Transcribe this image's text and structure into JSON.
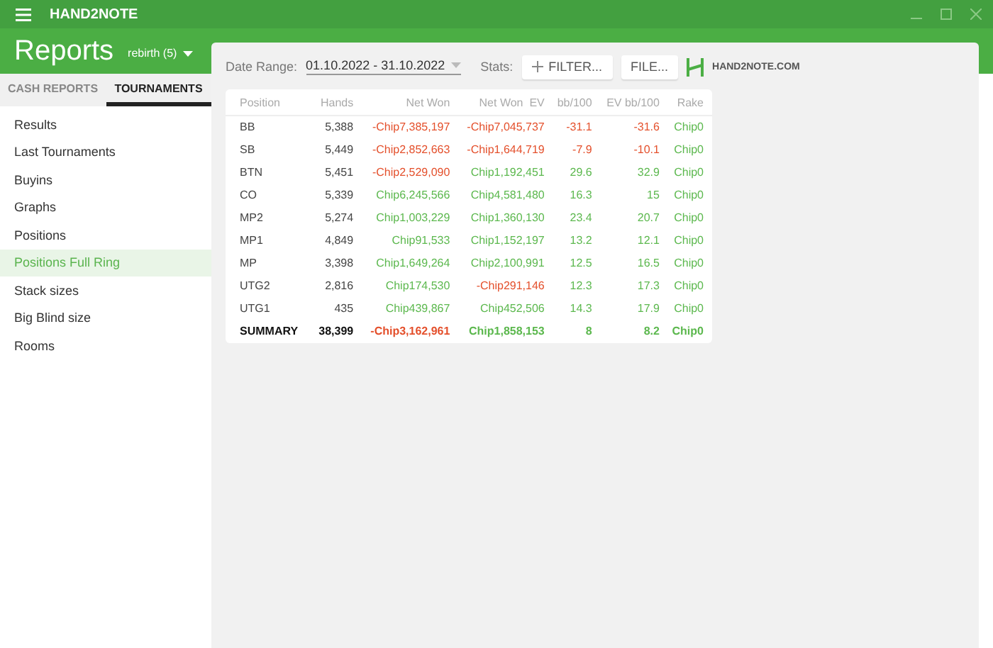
{
  "window": {
    "title": "HAND2NOTE"
  },
  "header": {
    "title": "Reports",
    "profile": "rebirth (5)"
  },
  "tabs": [
    {
      "label": "CASH REPORTS",
      "selected": false
    },
    {
      "label": "TOURNAMENTS",
      "selected": true
    }
  ],
  "sidebar": {
    "items": [
      {
        "label": "Results",
        "selected": false
      },
      {
        "label": "Last Tournaments",
        "selected": false
      },
      {
        "label": "Buyins",
        "selected": false
      },
      {
        "label": "Graphs",
        "selected": false
      },
      {
        "label": "Positions",
        "selected": false
      },
      {
        "label": "Positions Full Ring",
        "selected": true
      },
      {
        "label": "Stack sizes",
        "selected": false
      },
      {
        "label": "Big Blind size",
        "selected": false
      },
      {
        "label": "Rooms",
        "selected": false
      }
    ]
  },
  "toolbar": {
    "date_label": "Date Range:",
    "date_value": "01.10.2022 - 31.10.2022",
    "stats_label": "Stats:",
    "filter_button": "FILTER...",
    "file_button": "FILE...",
    "brand": "HAND2NOTE.COM"
  },
  "table": {
    "columns": [
      "Position",
      "Hands",
      "Net Won",
      "Net Won  EV",
      "bb/100",
      "EV bb/100",
      "Rake"
    ],
    "rows": [
      {
        "kind": "row",
        "position": "BB",
        "hands": "5,388",
        "values": [
          {
            "text": "-Chip7,385,197",
            "color": "#e4502c"
          },
          {
            "text": "-Chip7,045,737",
            "color": "#e4502c"
          },
          {
            "text": "-31.1",
            "color": "#e4502c"
          },
          {
            "text": "-31.6",
            "color": "#e4502c"
          },
          {
            "text": "Chip0",
            "color": "#5cb84e"
          }
        ]
      },
      {
        "kind": "row",
        "position": "SB",
        "hands": "5,449",
        "values": [
          {
            "text": "-Chip2,852,663",
            "color": "#e4502c"
          },
          {
            "text": "-Chip1,644,719",
            "color": "#e4502c"
          },
          {
            "text": "-7.9",
            "color": "#e4502c"
          },
          {
            "text": "-10.1",
            "color": "#e4502c"
          },
          {
            "text": "Chip0",
            "color": "#5cb84e"
          }
        ]
      },
      {
        "kind": "row",
        "position": "BTN",
        "hands": "5,451",
        "values": [
          {
            "text": "-Chip2,529,090",
            "color": "#e4502c"
          },
          {
            "text": "Chip1,192,451",
            "color": "#5cb84e"
          },
          {
            "text": "29.6",
            "color": "#5cb84e"
          },
          {
            "text": "32.9",
            "color": "#5cb84e"
          },
          {
            "text": "Chip0",
            "color": "#5cb84e"
          }
        ]
      },
      {
        "kind": "row",
        "position": "CO",
        "hands": "5,339",
        "values": [
          {
            "text": "Chip6,245,566",
            "color": "#5cb84e"
          },
          {
            "text": "Chip4,581,480",
            "color": "#5cb84e"
          },
          {
            "text": "16.3",
            "color": "#5cb84e"
          },
          {
            "text": "15",
            "color": "#5cb84e"
          },
          {
            "text": "Chip0",
            "color": "#5cb84e"
          }
        ]
      },
      {
        "kind": "row",
        "position": "MP2",
        "hands": "5,274",
        "values": [
          {
            "text": "Chip1,003,229",
            "color": "#5cb84e"
          },
          {
            "text": "Chip1,360,130",
            "color": "#5cb84e"
          },
          {
            "text": "23.4",
            "color": "#5cb84e"
          },
          {
            "text": "20.7",
            "color": "#5cb84e"
          },
          {
            "text": "Chip0",
            "color": "#5cb84e"
          }
        ]
      },
      {
        "kind": "row",
        "position": "MP1",
        "hands": "4,849",
        "values": [
          {
            "text": "Chip91,533",
            "color": "#5cb84e"
          },
          {
            "text": "Chip1,152,197",
            "color": "#5cb84e"
          },
          {
            "text": "13.2",
            "color": "#5cb84e"
          },
          {
            "text": "12.1",
            "color": "#5cb84e"
          },
          {
            "text": "Chip0",
            "color": "#5cb84e"
          }
        ]
      },
      {
        "kind": "row",
        "position": "MP",
        "hands": "3,398",
        "values": [
          {
            "text": "Chip1,649,264",
            "color": "#5cb84e"
          },
          {
            "text": "Chip2,100,991",
            "color": "#5cb84e"
          },
          {
            "text": "12.5",
            "color": "#5cb84e"
          },
          {
            "text": "16.5",
            "color": "#5cb84e"
          },
          {
            "text": "Chip0",
            "color": "#5cb84e"
          }
        ]
      },
      {
        "kind": "row",
        "position": "UTG2",
        "hands": "2,816",
        "values": [
          {
            "text": "Chip174,530",
            "color": "#5cb84e"
          },
          {
            "text": "-Chip291,146",
            "color": "#e4502c"
          },
          {
            "text": "12.3",
            "color": "#5cb84e"
          },
          {
            "text": "17.3",
            "color": "#5cb84e"
          },
          {
            "text": "Chip0",
            "color": "#5cb84e"
          }
        ]
      },
      {
        "kind": "row",
        "position": "UTG1",
        "hands": "435",
        "values": [
          {
            "text": "Chip439,867",
            "color": "#5cb84e"
          },
          {
            "text": "Chip452,506",
            "color": "#5cb84e"
          },
          {
            "text": "14.3",
            "color": "#5cb84e"
          },
          {
            "text": "17.9",
            "color": "#5cb84e"
          },
          {
            "text": "Chip0",
            "color": "#5cb84e"
          }
        ]
      },
      {
        "kind": "summary",
        "position": "SUMMARY",
        "hands": "38,399",
        "values": [
          {
            "text": "-Chip3,162,961",
            "color": "#e4502c"
          },
          {
            "text": "Chip1,858,153",
            "color": "#5cb84e"
          },
          {
            "text": "8",
            "color": "#5cb84e"
          },
          {
            "text": "8.2",
            "color": "#5cb84e"
          },
          {
            "text": "Chip0",
            "color": "#5cb84e"
          }
        ]
      }
    ]
  }
}
